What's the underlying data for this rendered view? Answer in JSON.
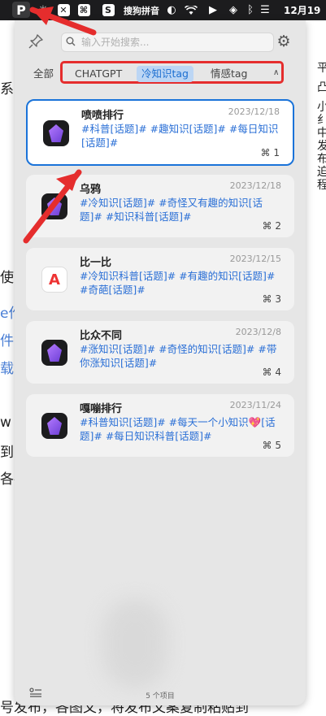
{
  "menubar": {
    "app_icon": "P",
    "sogou": "搜狗拼音",
    "date": "12月19"
  },
  "background_text": {
    "left": [
      "系",
      "使",
      "e作",
      "件",
      "载",
      "w",
      "到贝",
      "各布"
    ],
    "right": [
      "平",
      "凸",
      "小",
      "纟",
      "中",
      "发",
      "布",
      "迫",
      "程"
    ],
    "bottom": "号发布，各图文，将发布文案复制粘贴到"
  },
  "panel": {
    "search": {
      "placeholder": "输入开始搜索..."
    },
    "tabs": [
      "全部",
      "CHATGPT",
      "冷知识tag",
      "情感tag"
    ],
    "active_tab": "冷知识tag",
    "tabs_more": "∧",
    "cards": [
      {
        "title": "喷喷排行",
        "date": "2023/12/18",
        "tags": "#科普[话题]# #趣知识[话题]# #每日知识[话题]#",
        "shortcut": "⌘ 1",
        "icon": "gem-icon"
      },
      {
        "title": "乌鸦",
        "date": "2023/12/18",
        "tags": "#冷知识[话题]# #奇怪又有趣的知识[话题]# #知识科普[话题]#",
        "shortcut": "⌘ 2",
        "icon": "gem-icon"
      },
      {
        "title": "比一比",
        "date": "2023/12/15",
        "tags": "#冷知识科普[话题]# #有趣的知识[话题]# #奇葩[话题]#",
        "shortcut": "⌘ 3",
        "icon": "a-logo-icon"
      },
      {
        "title": "比众不同",
        "date": "2023/12/8",
        "tags": "#涨知识[话题]# #奇怪的知识[话题]# #带你涨知识[话题]#",
        "shortcut": "⌘ 4",
        "icon": "gem-icon"
      },
      {
        "title": "嘎嘣排行",
        "date": "2023/11/24",
        "tags": "#科普知识[话题]# #每天一个小知识💖[话题]# #每日知识科普[话题]#",
        "shortcut": "⌘ 5",
        "icon": "gem-icon"
      }
    ],
    "footer": {
      "count": "5 个项目"
    }
  },
  "colors": {
    "accent": "#1a73d9",
    "tag_text": "#2a6fd6",
    "annotation_red": "#e52d2d"
  }
}
